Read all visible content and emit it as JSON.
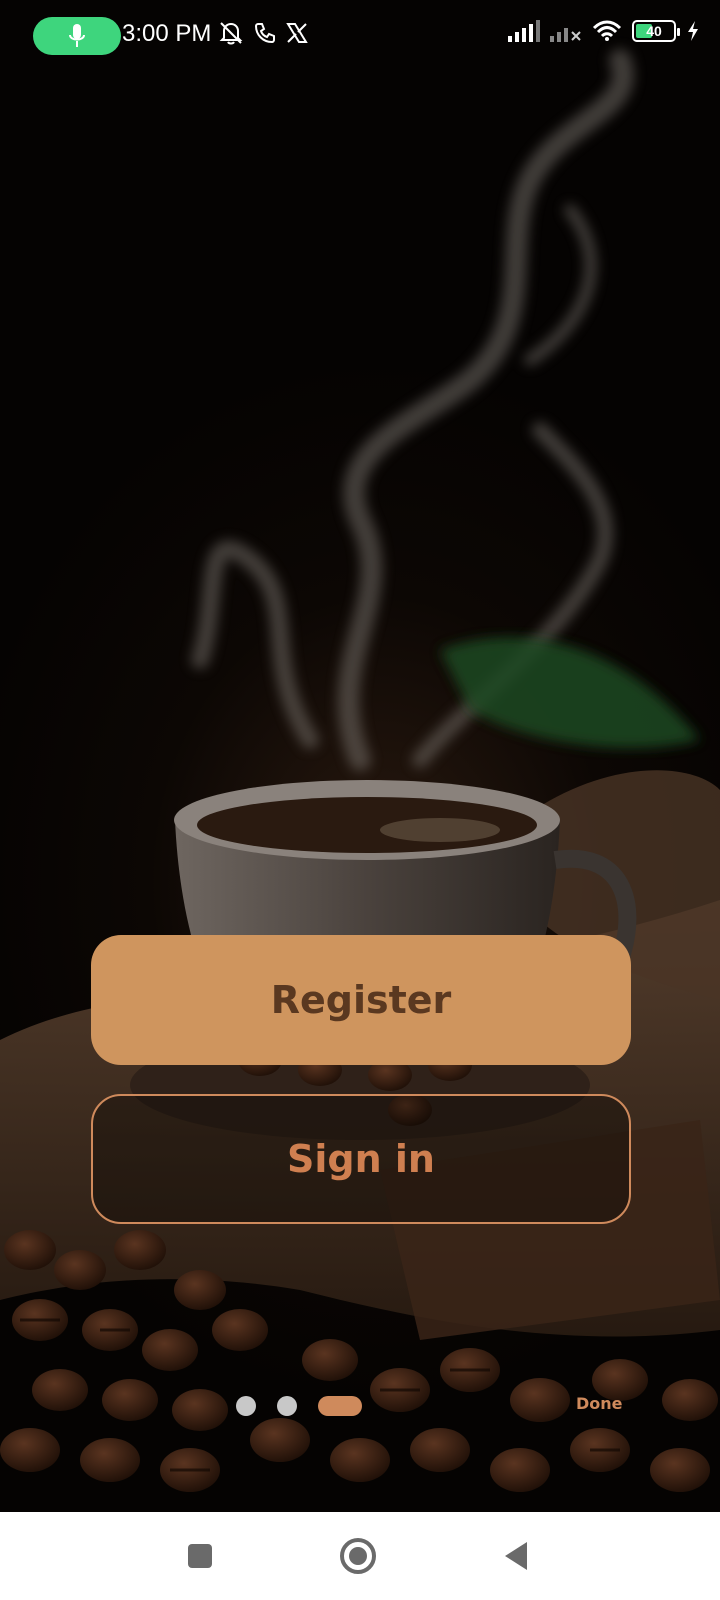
{
  "status_bar": {
    "time": "3:00 PM",
    "battery_level": "40",
    "icons_left": [
      "mic-icon",
      "bell-off-icon",
      "phone-icon",
      "x-logo-icon"
    ],
    "icons_right": [
      "signal-icon",
      "signal-no-service-icon",
      "wifi-icon",
      "battery-icon",
      "charging-icon"
    ],
    "mic_pill_color": "#3ed57d"
  },
  "actions": {
    "register_label": "Register",
    "signin_label": "Sign in"
  },
  "pager": {
    "pages": 3,
    "active_index": 2,
    "done_label": "Done"
  },
  "nav_bar": {
    "buttons": [
      "recents-square-icon",
      "home-circle-icon",
      "back-triangle-icon"
    ]
  },
  "colors": {
    "accent": "#cf955e",
    "accent_text": "#5a3820",
    "outline": "#cf8a5c"
  }
}
